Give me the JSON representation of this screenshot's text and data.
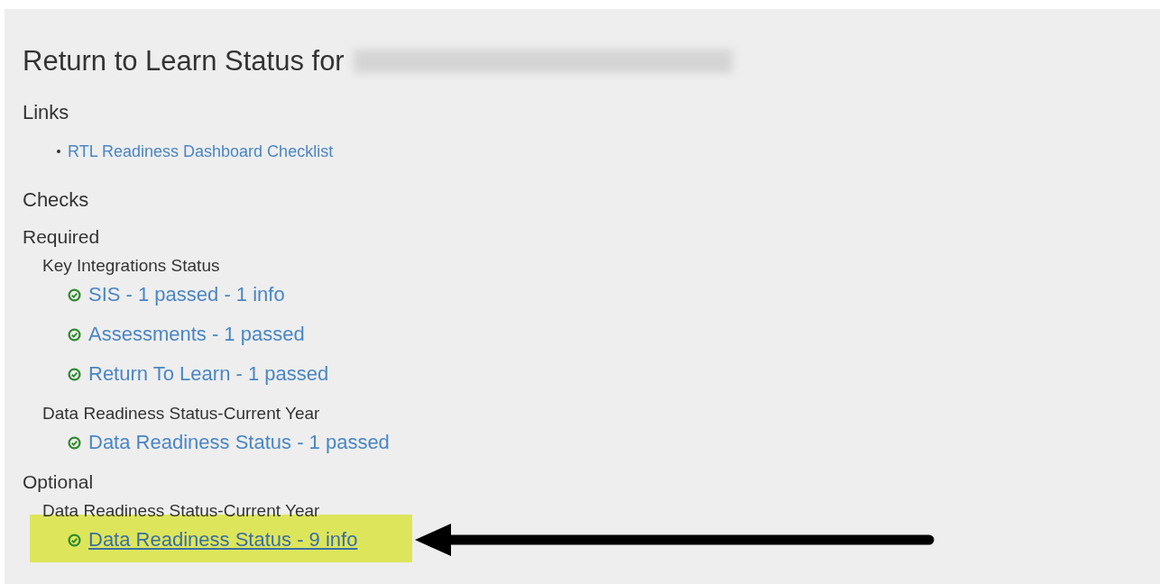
{
  "title": "Return to Learn Status for",
  "links": {
    "heading": "Links",
    "items": [
      "RTL Readiness Dashboard Checklist"
    ]
  },
  "checks": {
    "heading": "Checks",
    "sections": [
      {
        "heading": "Required",
        "groups": [
          {
            "heading": "Key Integrations Status",
            "items": [
              {
                "label": "SIS - 1 passed - 1 info",
                "highlighted": false
              },
              {
                "label": "Assessments - 1 passed",
                "highlighted": false
              },
              {
                "label": "Return To Learn - 1 passed",
                "highlighted": false
              }
            ]
          },
          {
            "heading": "Data Readiness Status-Current Year",
            "items": [
              {
                "label": "Data Readiness Status - 1 passed",
                "highlighted": false
              }
            ]
          }
        ]
      },
      {
        "heading": "Optional",
        "groups": [
          {
            "heading": "Data Readiness Status-Current Year",
            "items": [
              {
                "label": "Data Readiness Status - 9 info",
                "highlighted": true
              }
            ]
          }
        ]
      }
    ]
  }
}
